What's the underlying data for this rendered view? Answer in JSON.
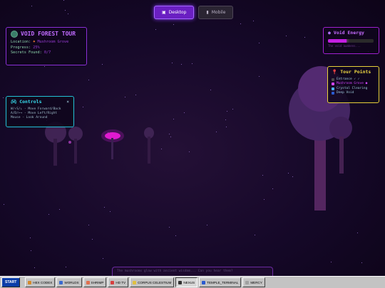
{
  "mode_toggle": {
    "desktop_label": "Desktop",
    "mobile_label": "Mobile"
  },
  "tour_panel": {
    "title": "VOID FOREST TOUR",
    "location_label": "Location:",
    "location_value": "Mushroom Grove",
    "progress_label": "Progress:",
    "progress_value": "25%",
    "secrets_label": "Secrets Found:",
    "secrets_value": "0/7"
  },
  "controls_panel": {
    "title": "Controls",
    "close": "×",
    "lines": [
      "W/↑S/↓ - Move Forward/Back",
      "A/D/←→ - Move Left/Right",
      "Mouse - Look Around"
    ]
  },
  "energy_panel": {
    "title": "Void Energy",
    "level": 0.4,
    "note": "The void awakens..."
  },
  "points_panel": {
    "title": "Tour Points",
    "items": [
      {
        "label": "Entrance ✓ ✓",
        "color": "#4a4a4a"
      },
      {
        "label": "Mushroom Grove ●",
        "color": "#d245ff"
      },
      {
        "label": "Crystal Clearing",
        "color": "#4ab0ff"
      },
      {
        "label": "Deep Void",
        "color": "#2a5ad0"
      }
    ]
  },
  "dialog": {
    "text": "The mushrooms glow with ancient wisdom... Can you hear them?"
  },
  "taskbar": {
    "start_label": "START",
    "buttons": [
      {
        "label": "HEX CODEX",
        "color": "#d58a2a"
      },
      {
        "label": "WORLDS",
        "color": "#3a6ad0"
      },
      {
        "label": "SHRIMP",
        "color": "#e07050"
      },
      {
        "label": "HD TV",
        "color": "#d64040"
      },
      {
        "label": "CORPUS CELESTIUM",
        "color": "#e0c040"
      },
      {
        "label": "NEXUS",
        "color": "#303030"
      },
      {
        "label": "TEMPLE_TERMINAL",
        "color": "#2a5ad0"
      },
      {
        "label": "MERCY",
        "color": "#a0a0a0"
      }
    ]
  },
  "colors": {
    "accent": "#6a1fc2",
    "panel_purple": "#8a2fd6",
    "panel_cyan": "#22c3d6",
    "panel_yellow": "#e8d23a"
  }
}
